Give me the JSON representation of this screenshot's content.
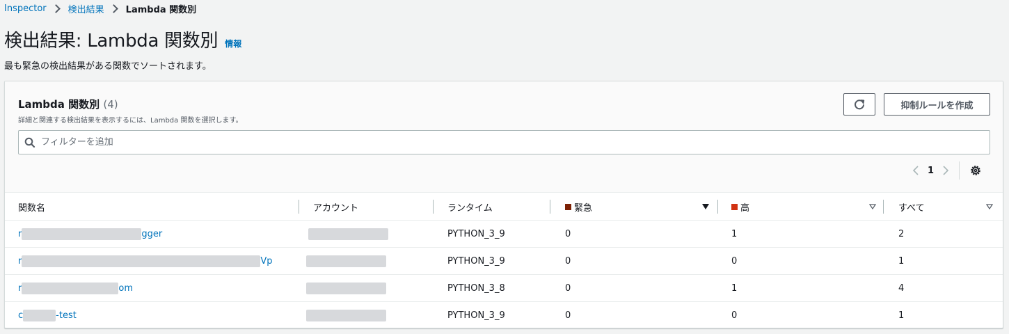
{
  "breadcrumb": {
    "items": [
      "Inspector",
      "検出結果"
    ],
    "current": "Lambda 関数別"
  },
  "page": {
    "title": "検出結果: Lambda 関数別",
    "info_link": "情報",
    "description": "最も緊急の検出結果がある関数でソートされます。"
  },
  "panel": {
    "title": "Lambda 関数別",
    "count": "(4)",
    "description": "詳細と関連する検出結果を表示するには、Lambda 関数を選択します。",
    "create_button": "抑制ルールを作成",
    "refresh_icon": "refresh-icon",
    "filter_placeholder": "フィルターを追加"
  },
  "pagination": {
    "current_page": "1"
  },
  "colors": {
    "critical": "#7d2105",
    "high": "#d13212",
    "link": "#0073bb"
  },
  "table": {
    "columns": {
      "function_name": "関数名",
      "account": "アカウント",
      "runtime": "ランタイム",
      "critical": "緊急",
      "high": "高",
      "all": "すべて"
    },
    "rows": [
      {
        "name_start": "r",
        "name_end": "gger",
        "runtime": "PYTHON_3_9",
        "critical": "0",
        "high": "1",
        "all": "2"
      },
      {
        "name_start": "r",
        "name_end": "Vp",
        "runtime": "PYTHON_3_9",
        "critical": "0",
        "high": "0",
        "all": "1"
      },
      {
        "name_start": "r",
        "name_end": "om",
        "runtime": "PYTHON_3_8",
        "critical": "0",
        "high": "1",
        "all": "4"
      },
      {
        "name_start": "c",
        "name_end": "-test",
        "runtime": "PYTHON_3_9",
        "critical": "0",
        "high": "0",
        "all": "1"
      }
    ]
  }
}
